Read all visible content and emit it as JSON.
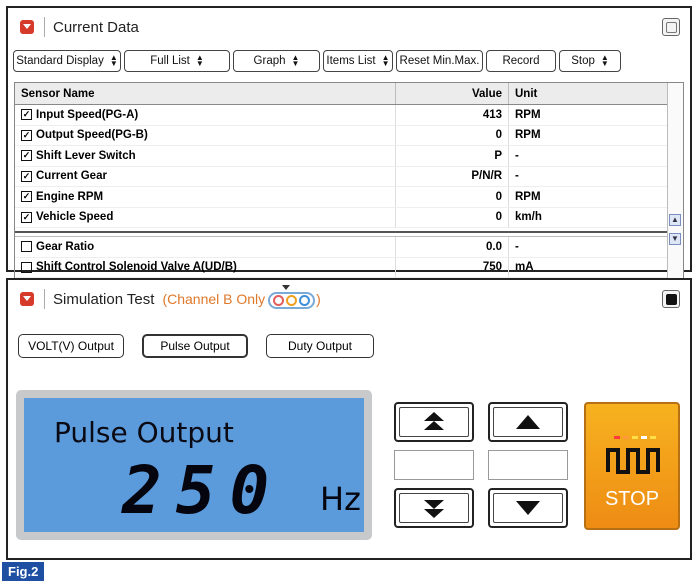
{
  "current_data": {
    "title": "Current Data",
    "toolbar": [
      {
        "label": "Standard Display",
        "updown": true,
        "width": 108
      },
      {
        "label": "Full List",
        "updown": true,
        "width": 106
      },
      {
        "label": "Graph",
        "updown": true,
        "width": 87
      },
      {
        "label": "Items List",
        "updown": true,
        "width": 70
      },
      {
        "label": "Reset Min.Max.",
        "updown": false,
        "width": 87
      },
      {
        "label": "Record",
        "updown": false,
        "width": 70
      },
      {
        "label": "Stop",
        "updown": true,
        "width": 62
      }
    ],
    "columns": {
      "name": "Sensor Name",
      "value": "Value",
      "unit": "Unit"
    },
    "rows": [
      {
        "checked": true,
        "name": "Input Speed(PG-A)",
        "value": "413",
        "unit": "RPM"
      },
      {
        "checked": true,
        "name": "Output Speed(PG-B)",
        "value": "0",
        "unit": "RPM"
      },
      {
        "checked": true,
        "name": "Shift Lever Switch",
        "value": "P",
        "unit": "-"
      },
      {
        "checked": true,
        "name": "Current Gear",
        "value": "P/N/R",
        "unit": "-"
      },
      {
        "checked": true,
        "name": "Engine RPM",
        "value": "0",
        "unit": "RPM"
      },
      {
        "checked": true,
        "name": "Vehicle Speed",
        "value": "0",
        "unit": "km/h"
      }
    ],
    "extra_rows": [
      {
        "checked": false,
        "name": "Gear Ratio",
        "value": "0.0",
        "unit": "-"
      },
      {
        "checked": false,
        "name": "Shift Control Solenoid Valve A(UD/B)",
        "value": "750",
        "unit": "mA"
      }
    ]
  },
  "simulation": {
    "title": "Simulation Test",
    "channel_note": "(Channel B Only",
    "channel_dots": [
      "#e35d5d",
      "#f0a020",
      "#3f8fd8"
    ],
    "output_buttons": [
      {
        "label": "VOLT(V) Output",
        "width": 106,
        "bold": false
      },
      {
        "label": "Pulse Output",
        "width": 106,
        "bold": true
      },
      {
        "label": "Duty Output",
        "width": 108,
        "bold": false
      }
    ],
    "lcd": {
      "mode": "Pulse Output",
      "value": "250",
      "unit": "Hz"
    },
    "stop_label": "STOP",
    "stop_dashes": [
      "#ff3b3b",
      "#ff9a3b",
      "#ffe04a",
      "#ffffff",
      "#ffe04a"
    ]
  },
  "figure_label": "Fig.2",
  "colors": {
    "accent_red": "#d63a2a",
    "lcd_blue": "#5b9bdc",
    "stop_orange": "#f29a17",
    "fig_blue": "#1f4fa3"
  }
}
